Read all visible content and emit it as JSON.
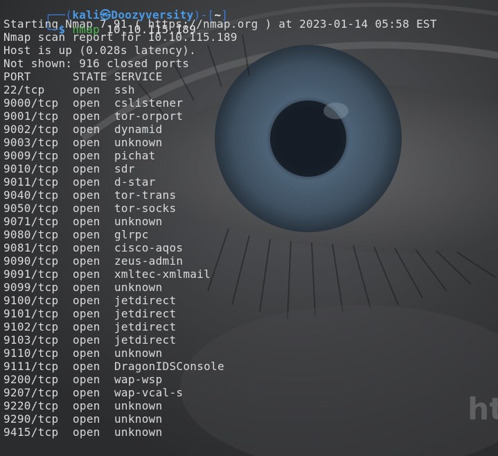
{
  "prompt": {
    "tree_top": "┌──(",
    "user": "kali",
    "at_symbol": "㉿",
    "host": "Doozyversity",
    "sep": ")-[",
    "cwd": "~",
    "close": "]",
    "tree_bottom": "└─",
    "dollar": "$",
    "command": "nmap",
    "argument": "10.10.115.189"
  },
  "output": {
    "line1": "Starting Nmap 7.91 ( https://nmap.org ) at 2023-01-14 05:58 EST",
    "line2": "Nmap scan report for 10.10.115.189",
    "line3": "Host is up (0.028s latency).",
    "line4": "Not shown: 916 closed ports"
  },
  "table": {
    "headers": {
      "port": "PORT",
      "state": "STATE",
      "service": "SERVICE"
    },
    "rows": [
      {
        "port": "22/tcp",
        "state": "open",
        "service": "ssh"
      },
      {
        "port": "9000/tcp",
        "state": "open",
        "service": "cslistener"
      },
      {
        "port": "9001/tcp",
        "state": "open",
        "service": "tor-orport"
      },
      {
        "port": "9002/tcp",
        "state": "open",
        "service": "dynamid"
      },
      {
        "port": "9003/tcp",
        "state": "open",
        "service": "unknown"
      },
      {
        "port": "9009/tcp",
        "state": "open",
        "service": "pichat"
      },
      {
        "port": "9010/tcp",
        "state": "open",
        "service": "sdr"
      },
      {
        "port": "9011/tcp",
        "state": "open",
        "service": "d-star"
      },
      {
        "port": "9040/tcp",
        "state": "open",
        "service": "tor-trans"
      },
      {
        "port": "9050/tcp",
        "state": "open",
        "service": "tor-socks"
      },
      {
        "port": "9071/tcp",
        "state": "open",
        "service": "unknown"
      },
      {
        "port": "9080/tcp",
        "state": "open",
        "service": "glrpc"
      },
      {
        "port": "9081/tcp",
        "state": "open",
        "service": "cisco-aqos"
      },
      {
        "port": "9090/tcp",
        "state": "open",
        "service": "zeus-admin"
      },
      {
        "port": "9091/tcp",
        "state": "open",
        "service": "xmltec-xmlmail"
      },
      {
        "port": "9099/tcp",
        "state": "open",
        "service": "unknown"
      },
      {
        "port": "9100/tcp",
        "state": "open",
        "service": "jetdirect"
      },
      {
        "port": "9101/tcp",
        "state": "open",
        "service": "jetdirect"
      },
      {
        "port": "9102/tcp",
        "state": "open",
        "service": "jetdirect"
      },
      {
        "port": "9103/tcp",
        "state": "open",
        "service": "jetdirect"
      },
      {
        "port": "9110/tcp",
        "state": "open",
        "service": "unknown"
      },
      {
        "port": "9111/tcp",
        "state": "open",
        "service": "DragonIDSConsole"
      },
      {
        "port": "9200/tcp",
        "state": "open",
        "service": "wap-wsp"
      },
      {
        "port": "9207/tcp",
        "state": "open",
        "service": "wap-vcal-s"
      },
      {
        "port": "9220/tcp",
        "state": "open",
        "service": "unknown"
      },
      {
        "port": "9290/tcp",
        "state": "open",
        "service": "unknown"
      },
      {
        "port": "9415/tcp",
        "state": "open",
        "service": "unknown"
      }
    ]
  },
  "wallpaper": {
    "icon": "eye-wallpaper-icon",
    "text": "ht"
  },
  "colors": {
    "background": "#2f3032",
    "text": "#dcdcdc",
    "prompt_blue": "#4a9ae8",
    "command_green": "#4fb84f"
  }
}
